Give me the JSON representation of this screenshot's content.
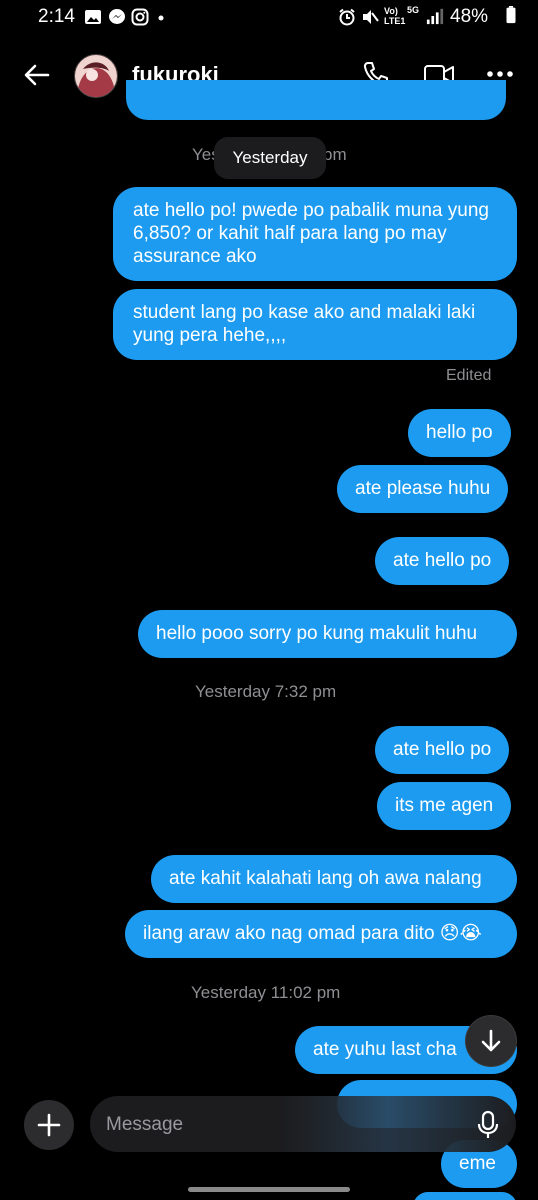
{
  "status_bar": {
    "time": "2:14",
    "network": "5G",
    "network_sub": "LTE1",
    "volte": "Vo)",
    "battery": "48%"
  },
  "header": {
    "contact_name": "fukuroki"
  },
  "date_pill": "Yesterday",
  "messages": [
    {
      "text": "ate hello po! pwede po pabalik muna yung 6,850? or kahit half para lang po may assurance ako"
    },
    {
      "text": "student lang po kase ako and malaki laki yung pera hehe,,,,"
    },
    {
      "text": "hello po"
    },
    {
      "text": "ate please huhu"
    },
    {
      "text": "ate hello po"
    },
    {
      "text": "hello pooo sorry po kung makulit huhu"
    },
    {
      "text": "ate hello po"
    },
    {
      "text": "its me agen"
    },
    {
      "text": "ate kahit kalahati lang oh awa nalang"
    },
    {
      "text": "ilang araw ako nag omad para dito 😞😭"
    },
    {
      "text": "ate yuhu last cha"
    },
    {
      "text": "eme"
    }
  ],
  "edited_label": "Edited",
  "timestamps": [
    "Yesterday 7:32 pm",
    "Yesterday 11:02 pm"
  ],
  "header_timestamp_partial_left": "Yes",
  "header_timestamp_partial_right": "pm",
  "composer": {
    "placeholder": "Message"
  },
  "colors": {
    "bubble": "#1d9bf0",
    "background": "#000000",
    "timestamp": "#8e8e93"
  },
  "icons": [
    "back-arrow-icon",
    "phone-icon",
    "video-camera-icon",
    "more-dots-icon",
    "plus-icon",
    "microphone-icon",
    "arrow-down-icon"
  ]
}
